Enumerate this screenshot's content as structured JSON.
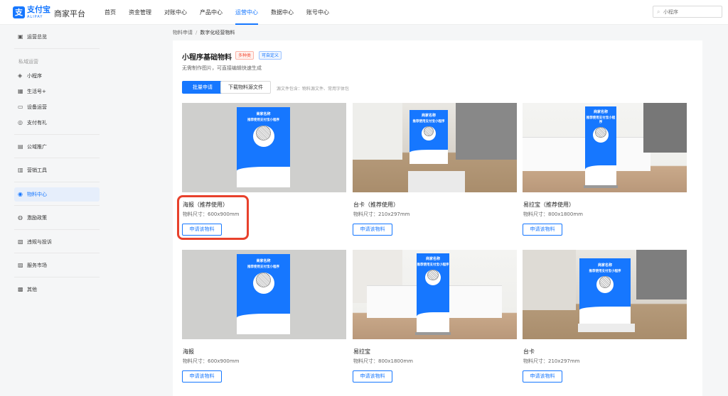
{
  "header": {
    "logo_glyph": "支",
    "logo_text": "支付宝",
    "logo_sub": "ALIPAY",
    "brand": "商家平台",
    "nav": [
      "首页",
      "资金管理",
      "对账中心",
      "产品中心",
      "运营中心",
      "数据中心",
      "账号中心"
    ],
    "active_nav": "运营中心",
    "search_placeholder": "小程序"
  },
  "sidebar": {
    "items": [
      {
        "label": "运营总览",
        "icon": "overview-icon",
        "glyph": "▣"
      },
      {
        "label": "小程序",
        "icon": "miniprogram-icon",
        "glyph": "◈"
      },
      {
        "label": "生活号+",
        "icon": "life-account-icon",
        "glyph": "▦"
      },
      {
        "label": "设备运营",
        "icon": "device-icon",
        "glyph": "▭"
      },
      {
        "label": "支付有礼",
        "icon": "gift-icon",
        "glyph": "◎"
      },
      {
        "label": "公域推广",
        "icon": "promotion-icon",
        "glyph": "▤"
      },
      {
        "label": "营销工具",
        "icon": "marketing-icon",
        "glyph": "▥"
      },
      {
        "label": "物料中心",
        "icon": "material-icon",
        "glyph": "◉"
      },
      {
        "label": "激励政策",
        "icon": "incentive-icon",
        "glyph": "◍"
      },
      {
        "label": "违规与投诉",
        "icon": "complaint-icon",
        "glyph": "▧"
      },
      {
        "label": "服务市场",
        "icon": "market-icon",
        "glyph": "▨"
      },
      {
        "label": "其他",
        "icon": "other-icon",
        "glyph": "▩"
      }
    ],
    "group_label": "私域运营",
    "active_item": "物料中心"
  },
  "breadcrumb": {
    "parent": "物料申请",
    "separator": "/",
    "current": "数字化经营物料"
  },
  "main": {
    "title": "小程序基础物料",
    "tags": [
      "多种类",
      "可自定义"
    ],
    "description": "无需制作图片，可直接编辑快速生成",
    "primary_button": "批量申请",
    "download_button": "下载物料源文件",
    "download_note": "源文件包含：物料源文件、常用字体包"
  },
  "poster": {
    "line1": "商家名称",
    "line2": "推荐使用支付宝小程序"
  },
  "cards": [
    {
      "name": "海报（推荐使用）",
      "size": "物料尺寸：600x900mm",
      "button": "申请该物料",
      "scene": "poster-wall"
    },
    {
      "name": "台卡（推荐使用）",
      "size": "物料尺寸：210x297mm",
      "button": "申请该物料",
      "scene": "desk-card"
    },
    {
      "name": "易拉宝（推荐使用）",
      "size": "物料尺寸：800x1800mm",
      "button": "申请该物料",
      "scene": "rollup"
    },
    {
      "name": "海报",
      "size": "物料尺寸：600x900mm",
      "button": "申请该物料",
      "scene": "poster-wall"
    },
    {
      "name": "易拉宝",
      "size": "物料尺寸：800x1800mm",
      "button": "申请该物料",
      "scene": "rollup"
    },
    {
      "name": "台卡",
      "size": "物料尺寸：210x297mm",
      "button": "申请该物料",
      "scene": "desk-card"
    }
  ],
  "colors": {
    "accent": "#1677ff",
    "highlight": "#e8412c"
  }
}
